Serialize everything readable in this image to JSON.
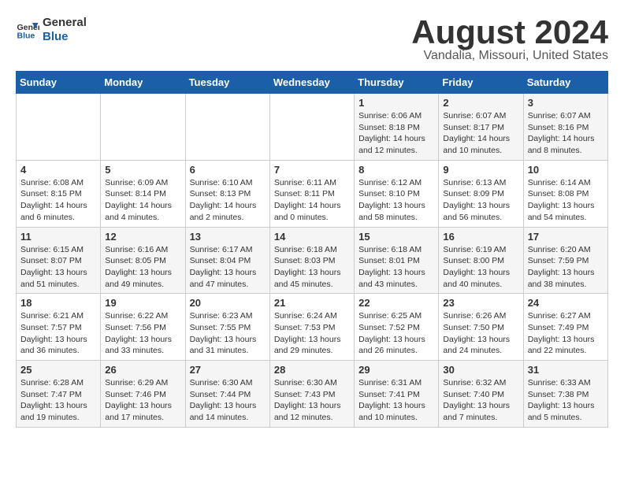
{
  "header": {
    "logo_line1": "General",
    "logo_line2": "Blue",
    "month": "August 2024",
    "location": "Vandalia, Missouri, United States"
  },
  "weekdays": [
    "Sunday",
    "Monday",
    "Tuesday",
    "Wednesday",
    "Thursday",
    "Friday",
    "Saturday"
  ],
  "weeks": [
    [
      {
        "day": "",
        "content": ""
      },
      {
        "day": "",
        "content": ""
      },
      {
        "day": "",
        "content": ""
      },
      {
        "day": "",
        "content": ""
      },
      {
        "day": "1",
        "content": "Sunrise: 6:06 AM\nSunset: 8:18 PM\nDaylight: 14 hours\nand 12 minutes."
      },
      {
        "day": "2",
        "content": "Sunrise: 6:07 AM\nSunset: 8:17 PM\nDaylight: 14 hours\nand 10 minutes."
      },
      {
        "day": "3",
        "content": "Sunrise: 6:07 AM\nSunset: 8:16 PM\nDaylight: 14 hours\nand 8 minutes."
      }
    ],
    [
      {
        "day": "4",
        "content": "Sunrise: 6:08 AM\nSunset: 8:15 PM\nDaylight: 14 hours\nand 6 minutes."
      },
      {
        "day": "5",
        "content": "Sunrise: 6:09 AM\nSunset: 8:14 PM\nDaylight: 14 hours\nand 4 minutes."
      },
      {
        "day": "6",
        "content": "Sunrise: 6:10 AM\nSunset: 8:13 PM\nDaylight: 14 hours\nand 2 minutes."
      },
      {
        "day": "7",
        "content": "Sunrise: 6:11 AM\nSunset: 8:11 PM\nDaylight: 14 hours\nand 0 minutes."
      },
      {
        "day": "8",
        "content": "Sunrise: 6:12 AM\nSunset: 8:10 PM\nDaylight: 13 hours\nand 58 minutes."
      },
      {
        "day": "9",
        "content": "Sunrise: 6:13 AM\nSunset: 8:09 PM\nDaylight: 13 hours\nand 56 minutes."
      },
      {
        "day": "10",
        "content": "Sunrise: 6:14 AM\nSunset: 8:08 PM\nDaylight: 13 hours\nand 54 minutes."
      }
    ],
    [
      {
        "day": "11",
        "content": "Sunrise: 6:15 AM\nSunset: 8:07 PM\nDaylight: 13 hours\nand 51 minutes."
      },
      {
        "day": "12",
        "content": "Sunrise: 6:16 AM\nSunset: 8:05 PM\nDaylight: 13 hours\nand 49 minutes."
      },
      {
        "day": "13",
        "content": "Sunrise: 6:17 AM\nSunset: 8:04 PM\nDaylight: 13 hours\nand 47 minutes."
      },
      {
        "day": "14",
        "content": "Sunrise: 6:18 AM\nSunset: 8:03 PM\nDaylight: 13 hours\nand 45 minutes."
      },
      {
        "day": "15",
        "content": "Sunrise: 6:18 AM\nSunset: 8:01 PM\nDaylight: 13 hours\nand 43 minutes."
      },
      {
        "day": "16",
        "content": "Sunrise: 6:19 AM\nSunset: 8:00 PM\nDaylight: 13 hours\nand 40 minutes."
      },
      {
        "day": "17",
        "content": "Sunrise: 6:20 AM\nSunset: 7:59 PM\nDaylight: 13 hours\nand 38 minutes."
      }
    ],
    [
      {
        "day": "18",
        "content": "Sunrise: 6:21 AM\nSunset: 7:57 PM\nDaylight: 13 hours\nand 36 minutes."
      },
      {
        "day": "19",
        "content": "Sunrise: 6:22 AM\nSunset: 7:56 PM\nDaylight: 13 hours\nand 33 minutes."
      },
      {
        "day": "20",
        "content": "Sunrise: 6:23 AM\nSunset: 7:55 PM\nDaylight: 13 hours\nand 31 minutes."
      },
      {
        "day": "21",
        "content": "Sunrise: 6:24 AM\nSunset: 7:53 PM\nDaylight: 13 hours\nand 29 minutes."
      },
      {
        "day": "22",
        "content": "Sunrise: 6:25 AM\nSunset: 7:52 PM\nDaylight: 13 hours\nand 26 minutes."
      },
      {
        "day": "23",
        "content": "Sunrise: 6:26 AM\nSunset: 7:50 PM\nDaylight: 13 hours\nand 24 minutes."
      },
      {
        "day": "24",
        "content": "Sunrise: 6:27 AM\nSunset: 7:49 PM\nDaylight: 13 hours\nand 22 minutes."
      }
    ],
    [
      {
        "day": "25",
        "content": "Sunrise: 6:28 AM\nSunset: 7:47 PM\nDaylight: 13 hours\nand 19 minutes."
      },
      {
        "day": "26",
        "content": "Sunrise: 6:29 AM\nSunset: 7:46 PM\nDaylight: 13 hours\nand 17 minutes."
      },
      {
        "day": "27",
        "content": "Sunrise: 6:30 AM\nSunset: 7:44 PM\nDaylight: 13 hours\nand 14 minutes."
      },
      {
        "day": "28",
        "content": "Sunrise: 6:30 AM\nSunset: 7:43 PM\nDaylight: 13 hours\nand 12 minutes."
      },
      {
        "day": "29",
        "content": "Sunrise: 6:31 AM\nSunset: 7:41 PM\nDaylight: 13 hours\nand 10 minutes."
      },
      {
        "day": "30",
        "content": "Sunrise: 6:32 AM\nSunset: 7:40 PM\nDaylight: 13 hours\nand 7 minutes."
      },
      {
        "day": "31",
        "content": "Sunrise: 6:33 AM\nSunset: 7:38 PM\nDaylight: 13 hours\nand 5 minutes."
      }
    ]
  ]
}
